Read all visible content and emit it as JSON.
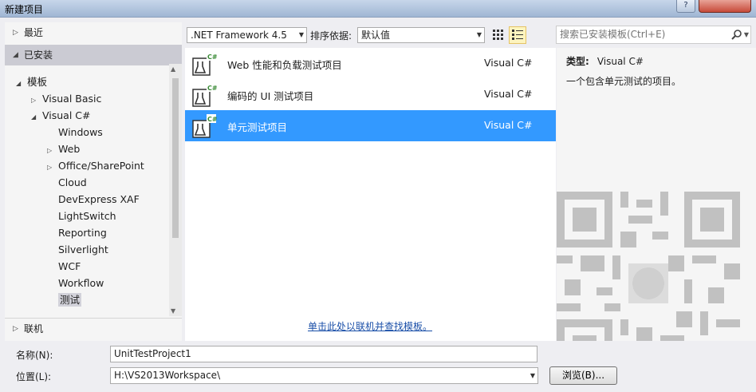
{
  "window": {
    "title": "新建项目"
  },
  "left": {
    "recent": "最近",
    "installed": "已安装",
    "online": "联机",
    "tree": [
      {
        "label": "模板",
        "level": 0,
        "arrow": "◢"
      },
      {
        "label": "Visual Basic",
        "level": 1,
        "arrow": "▷"
      },
      {
        "label": "Visual C#",
        "level": 1,
        "arrow": "◢"
      },
      {
        "label": "Windows",
        "level": 2,
        "arrow": ""
      },
      {
        "label": "Web",
        "level": 2,
        "arrow": "▷"
      },
      {
        "label": "Office/SharePoint",
        "level": 2,
        "arrow": "▷"
      },
      {
        "label": "Cloud",
        "level": 2,
        "arrow": ""
      },
      {
        "label": "DevExpress XAF",
        "level": 2,
        "arrow": ""
      },
      {
        "label": "LightSwitch",
        "level": 2,
        "arrow": ""
      },
      {
        "label": "Reporting",
        "level": 2,
        "arrow": ""
      },
      {
        "label": "Silverlight",
        "level": 2,
        "arrow": ""
      },
      {
        "label": "WCF",
        "level": 2,
        "arrow": ""
      },
      {
        "label": "Workflow",
        "level": 2,
        "arrow": ""
      },
      {
        "label": "测试",
        "level": 2,
        "arrow": "",
        "selected": true
      }
    ]
  },
  "toolbar": {
    "framework": ".NET Framework 4.5",
    "sort_label": "排序依据:",
    "sort_value": "默认值",
    "search_placeholder": "搜索已安装模板(Ctrl+E)"
  },
  "templates": [
    {
      "name": "Web 性能和负载测试项目",
      "lang": "Visual C#",
      "selected": false
    },
    {
      "name": "编码的 UI 测试项目",
      "lang": "Visual C#",
      "selected": false
    },
    {
      "name": "单元测试项目",
      "lang": "Visual C#",
      "selected": true
    }
  ],
  "online_link": "单击此处以联机并查找模板。",
  "details": {
    "type_label": "类型:",
    "type_value": "Visual C#",
    "description": "一个包含单元测试的项目。"
  },
  "bottom": {
    "name_label": "名称(N):",
    "name_value": "UnitTestProject1",
    "location_label": "位置(L):",
    "location_value": "H:\\VS2013Workspace\\",
    "browse_label": "浏览(B)..."
  },
  "colors": {
    "selection": "#3399ff",
    "link": "#1a4fa8"
  },
  "icons": [
    "search-icon",
    "small-icons-view-icon",
    "list-view-icon",
    "test-project-icon",
    "qr-code-watermark"
  ]
}
